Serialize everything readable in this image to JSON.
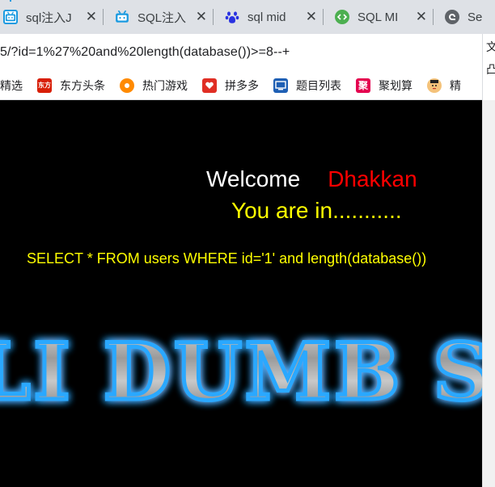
{
  "browser": {
    "tabs": [
      {
        "icon": "bilibili-icon",
        "title": "sql注入J"
      },
      {
        "icon": "bilibili-icon",
        "title": "SQL注入"
      },
      {
        "icon": "baidu-paw-icon",
        "title": "sql mid"
      },
      {
        "icon": "code-icon",
        "title": "SQL MI"
      },
      {
        "icon": "edge-icon",
        "title": "Se"
      }
    ],
    "close_glyph": "✕",
    "url": "5/?id=1%27%20and%20length(database())>=8--+",
    "bookmarks": [
      {
        "icon": "none",
        "label": "精选"
      },
      {
        "icon": "dongfang-icon",
        "icon_text": "东方",
        "label": "东方头条"
      },
      {
        "icon": "game-icon",
        "icon_text": "",
        "label": "热门游戏"
      },
      {
        "icon": "pinduoduo-icon",
        "icon_text": "",
        "label": "拼多多"
      },
      {
        "icon": "tiku-icon",
        "icon_text": "",
        "label": "题目列表"
      },
      {
        "icon": "juhuasuan-icon",
        "icon_text": "聚",
        "label": "聚划算"
      },
      {
        "icon": "avatar-icon",
        "icon_text": "",
        "label": "精"
      }
    ],
    "side_panel": {
      "line1": "文",
      "line2": "凸"
    }
  },
  "page": {
    "welcome": "Welcome",
    "user": "Dhakkan",
    "status": "You are in...........",
    "query": "SELECT * FROM users WHERE id='1' and length(database())",
    "banner": "LI DUMB SE"
  },
  "colors": {
    "background": "#000000",
    "welcome": "#ffffff",
    "user": "#ff0000",
    "status": "#ffff00",
    "banner_glow": "#29a8ff"
  }
}
